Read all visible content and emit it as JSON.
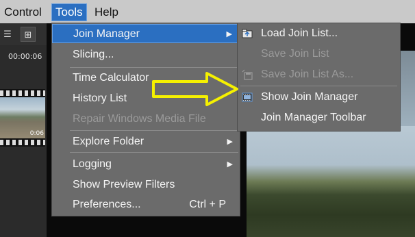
{
  "menubar": {
    "items": [
      {
        "label": "Control"
      },
      {
        "label": "Tools"
      },
      {
        "label": "Help"
      }
    ]
  },
  "left_panel": {
    "timecode": "00:00:06",
    "thumb_duration": "0:06"
  },
  "tools_menu": {
    "items": [
      {
        "label": "Join Manager",
        "submenu": true
      },
      {
        "label": "Slicing..."
      },
      {
        "label": "Time Calculator"
      },
      {
        "label": "History List"
      },
      {
        "label": "Repair Windows Media File",
        "disabled": true
      },
      {
        "label": "Explore Folder",
        "submenu": true
      },
      {
        "label": "Logging",
        "submenu": true
      },
      {
        "label": "Show Preview Filters"
      },
      {
        "label": "Preferences...",
        "shortcut": "Ctrl + P"
      }
    ]
  },
  "join_submenu": {
    "items": [
      {
        "label": "Load Join List...",
        "icon": "folder-open-icon"
      },
      {
        "label": "Save Join List",
        "disabled": true
      },
      {
        "label": "Save Join List As...",
        "disabled": true,
        "icon": "save-as-icon"
      },
      {
        "label": "Show Join Manager",
        "icon": "film-icon"
      },
      {
        "label": "Join Manager Toolbar"
      }
    ]
  },
  "colors": {
    "highlight": "#2b6fc1",
    "menu_bg": "#6b6b6b",
    "menubar_bg": "#c9c9c9",
    "annotation_arrow": "#f5f000"
  }
}
